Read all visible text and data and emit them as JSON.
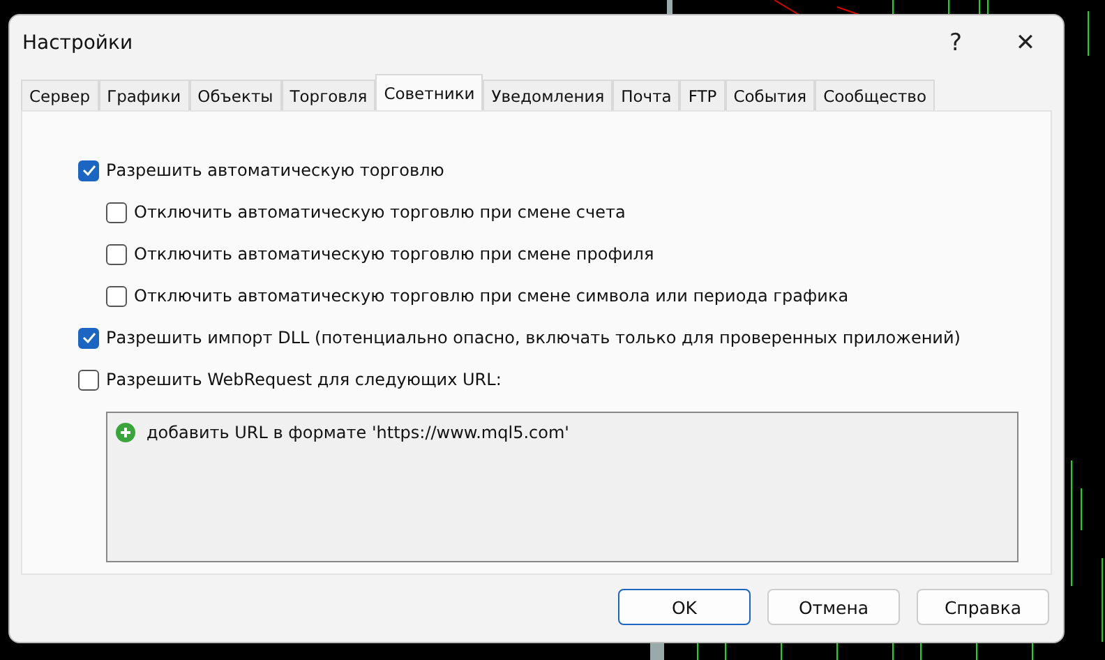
{
  "window": {
    "title": "Настройки",
    "help": "?",
    "close": "✕"
  },
  "tabs": [
    {
      "label": "Сервер",
      "selected": false
    },
    {
      "label": "Графики",
      "selected": false
    },
    {
      "label": "Объекты",
      "selected": false
    },
    {
      "label": "Торговля",
      "selected": false
    },
    {
      "label": "Советники",
      "selected": true
    },
    {
      "label": "Уведомления",
      "selected": false
    },
    {
      "label": "Почта",
      "selected": false
    },
    {
      "label": "FTP",
      "selected": false
    },
    {
      "label": "События",
      "selected": false
    },
    {
      "label": "Сообщество",
      "selected": false
    }
  ],
  "options": [
    {
      "label": "Разрешить автоматическую торговлю",
      "checked": true,
      "children": [
        {
          "label": "Отключить автоматическую торговлю при смене счета",
          "checked": false
        },
        {
          "label": "Отключить автоматическую торговлю при смене профиля",
          "checked": false
        },
        {
          "label": "Отключить автоматическую торговлю при смене символа или периода графика",
          "checked": false
        }
      ]
    },
    {
      "label": "Разрешить импорт DLL (потенциально опасно, включать только для проверенных приложений)",
      "checked": true
    },
    {
      "label": "Разрешить WebRequest для следующих URL:",
      "checked": false
    }
  ],
  "url_list": {
    "items": [
      "добавить URL в формате 'https://www.mql5.com'"
    ]
  },
  "buttons": [
    {
      "label": "OK",
      "kind": "primary"
    },
    {
      "label": "Отмена",
      "kind": "normal"
    },
    {
      "label": "Справка",
      "kind": "normal"
    }
  ]
}
